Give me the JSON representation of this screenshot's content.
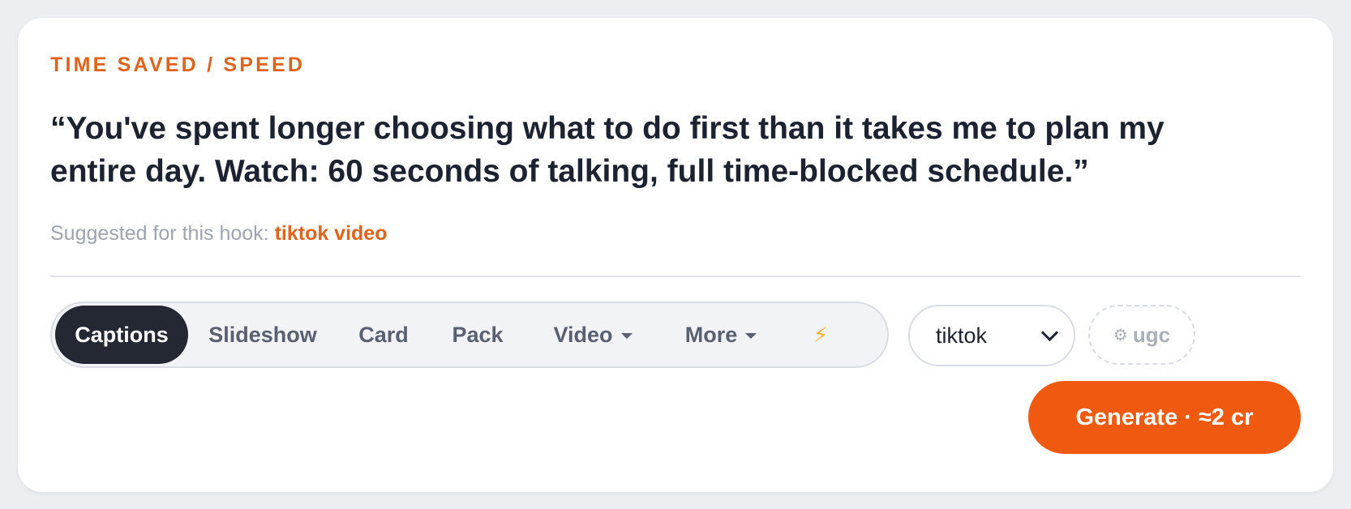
{
  "hook": {
    "category": "TIME SAVED / SPEED",
    "text": "“You've spent longer choosing what to do first than it takes me to plan my entire day. Watch: 60 seconds of talking, full time-blocked schedule.”",
    "suggested_label": "Suggested for this hook: ",
    "suggested_value": "tiktok video"
  },
  "modes": {
    "items": [
      {
        "label": "Captions",
        "active": true
      },
      {
        "label": "Slideshow"
      },
      {
        "label": "Card"
      },
      {
        "label": "Pack"
      },
      {
        "label": "Video",
        "has_dropdown": true
      },
      {
        "label": "More",
        "has_dropdown": true
      }
    ],
    "bolt_icon": "⚡"
  },
  "platform": {
    "selected": "tiktok"
  },
  "ugc": {
    "icon": "⚙",
    "label": "ugc"
  },
  "generate": {
    "label": "Generate · ≈2 cr"
  },
  "colors": {
    "accent": "#e0631b",
    "button": "#ef5a10",
    "active_tab": "#232833"
  }
}
